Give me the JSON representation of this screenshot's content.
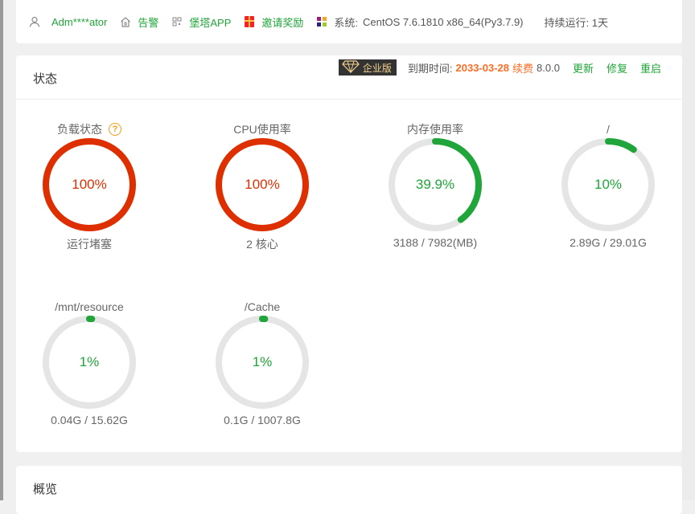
{
  "topbar": {
    "user": "Adm****ator",
    "alert": "告警",
    "app": "堡塔APP",
    "invite": "邀请奖励",
    "system_label": "系统:",
    "system_value": "CentOS 7.6.1810 x86_64(Py3.7.9)",
    "uptime": "持续运行: 1天"
  },
  "status": {
    "title": "状态",
    "badge": "企业版",
    "expire_label": "到期时间:",
    "expire_date": "2033-03-28",
    "renew": "续费",
    "version": "8.0.0",
    "update": "更新",
    "repair": "修复",
    "restart": "重启"
  },
  "gauges": [
    {
      "label": "负载状态",
      "value": "100%",
      "percent": 100,
      "sub": "运行堵塞",
      "color": "#dd2f00"
    },
    {
      "label": "CPU使用率",
      "value": "100%",
      "percent": 100,
      "sub": "2 核心",
      "color": "#dd2f00"
    },
    {
      "label": "内存使用率",
      "value": "39.9%",
      "percent": 39.9,
      "sub": "3188 / 7982(MB)",
      "color": "#20a53a"
    },
    {
      "label": "/",
      "value": "10%",
      "percent": 10,
      "sub": "2.89G / 29.01G",
      "color": "#20a53a"
    },
    {
      "label": "/mnt/resource",
      "value": "1%",
      "percent": 1,
      "sub": "0.04G / 15.62G",
      "color": "#20a53a"
    },
    {
      "label": "/Cache",
      "value": "1%",
      "percent": 1,
      "sub": "0.1G / 1007.8G",
      "color": "#20a53a"
    }
  ],
  "overview": {
    "title": "概览"
  }
}
